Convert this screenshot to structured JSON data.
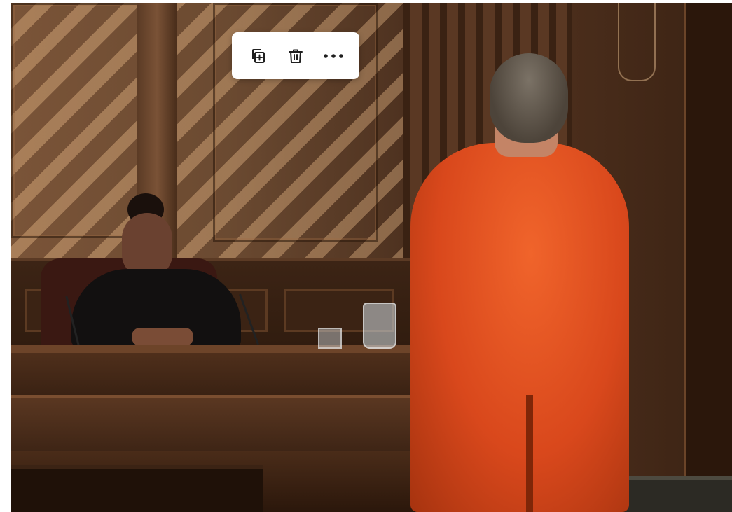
{
  "image": {
    "alt_description": ""
  },
  "toolbar": {
    "items": [
      {
        "icon": "duplicate-icon",
        "label": ""
      },
      {
        "icon": "trash-icon",
        "label": ""
      },
      {
        "icon": "more-horizontal-icon",
        "label": ""
      }
    ],
    "icon_color": "#1f1f1f",
    "background": "#ffffff"
  }
}
